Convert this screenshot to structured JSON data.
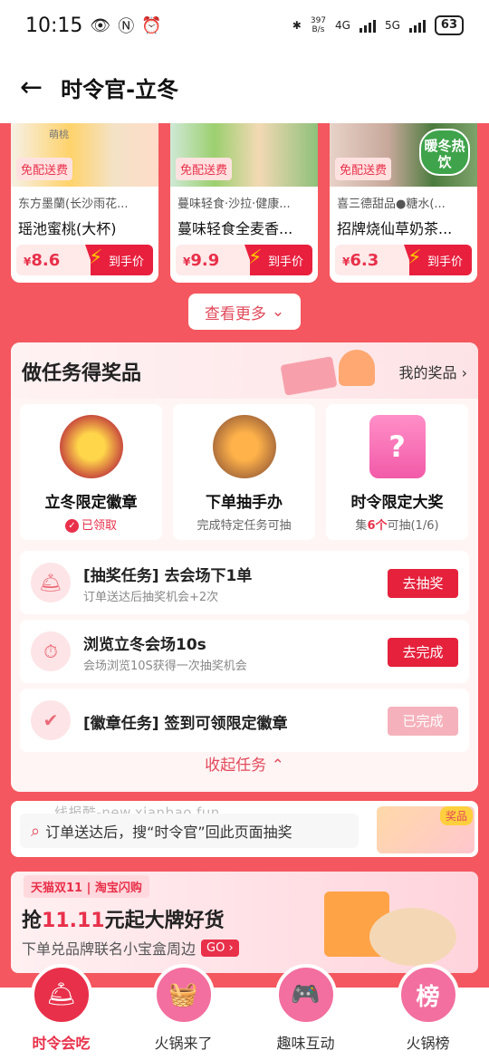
{
  "status_bar": {
    "time": "10:15",
    "net_speed_top": "397",
    "net_speed_bottom": "B/s",
    "net_4g": "4G",
    "net_5g": "5G",
    "battery": "63"
  },
  "header": {
    "title": "时令官-立冬"
  },
  "products": [
    {
      "badge": "免配送费",
      "shop": "东方墨蘭(长沙雨花...",
      "name": "瑶池蜜桃(大杯)",
      "price_symbol": "¥",
      "price": "8.6",
      "button": "到手价",
      "image_text": "萌桃"
    },
    {
      "badge": "免配送费",
      "shop": "蔓味轻食·沙拉·健康...",
      "name": "蔓味轻食全麦香...",
      "price_symbol": "¥",
      "price": "9.9",
      "button": "到手价"
    },
    {
      "badge": "免配送费",
      "shop": "喜三德甜品●糖水(...",
      "name": "招牌烧仙草奶茶...",
      "price_symbol": "¥",
      "price": "6.3",
      "button": "到手价",
      "hot_badge": "暖冬热饮"
    }
  ],
  "more_button": "查看更多",
  "task_panel": {
    "title": "做任务得奖品",
    "my_prizes": "我的奖品",
    "rewards": [
      {
        "name": "立冬限定徽章",
        "sub": "已领取"
      },
      {
        "name": "下单抽手办",
        "sub": "完成特定任务可抽"
      },
      {
        "name": "时令限定大奖",
        "sub_prefix": "集",
        "sub_count": "6个",
        "sub_suffix": "可抽(1/6)"
      }
    ],
    "tasks": [
      {
        "title": "[抽奖任务] 去会场下1单",
        "desc": "订单送达后抽奖机会+2次",
        "button": "去抽奖"
      },
      {
        "title": "浏览立冬会场10s",
        "desc": "会场浏览10S获得一次抽奖机会",
        "button": "去完成"
      },
      {
        "title": "[徽章任务] 签到可领限定徽章",
        "desc": "",
        "button": "已完成"
      }
    ],
    "collapse": "收起任务"
  },
  "search_hint": {
    "watermark": "线报酷-new.xianbao.fun",
    "text": "订单送达后，搜“时令官”回此页面抽奖",
    "prize_tag": "奖品"
  },
  "banner": {
    "tag": "天猫双11 | 淘宝闪购",
    "title_prefix": "抢",
    "title_highlight": "11.11",
    "title_suffix": "元起大牌好货",
    "sub": "下单兑品牌联名小宝盒周边",
    "go": "GO"
  },
  "bottom_nav": [
    {
      "label": "时令会吃",
      "icon": "bell-dome-icon",
      "glyph": "🛎"
    },
    {
      "label": "火锅来了",
      "icon": "basket-icon",
      "glyph": "🧺"
    },
    {
      "label": "趣味互动",
      "icon": "gamepad-icon",
      "glyph": "🎮"
    },
    {
      "label": "火锅榜",
      "icon": "ranking-icon",
      "glyph": "榜"
    }
  ]
}
